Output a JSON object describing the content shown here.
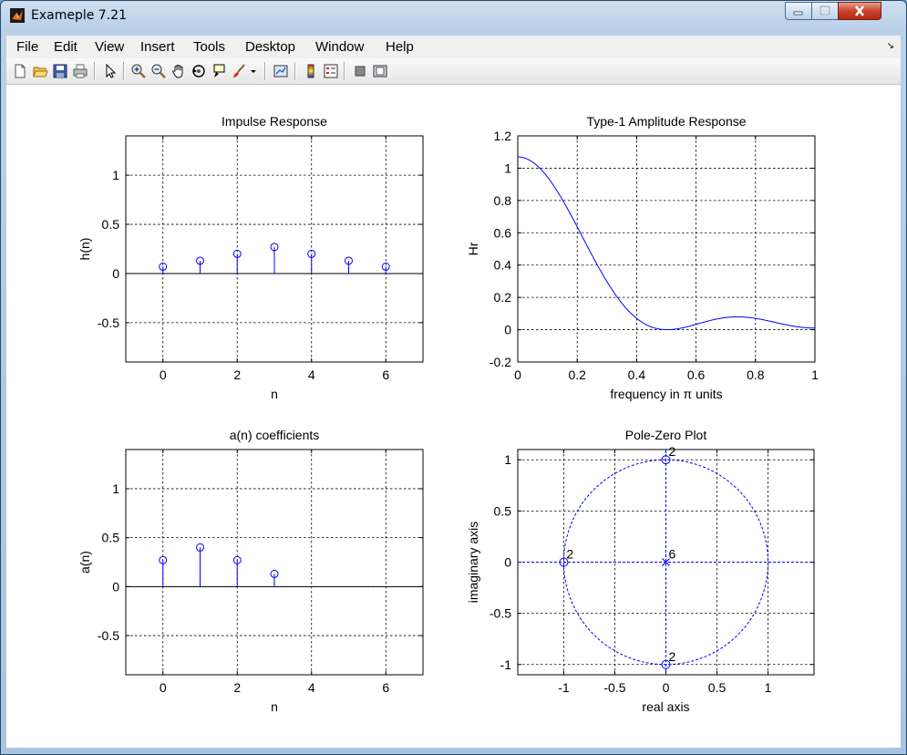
{
  "window": {
    "title": "Exameple 7.21"
  },
  "menu": [
    "File",
    "Edit",
    "View",
    "Insert",
    "Tools",
    "Desktop",
    "Window",
    "Help"
  ],
  "colors": {
    "stem": "#0000ff",
    "grid": "#000000",
    "accent": "#0000ff"
  },
  "toolbar_icons": [
    "new-figure-icon",
    "open-file-icon",
    "save-icon",
    "print-icon",
    "pointer-icon",
    "zoom-in-icon",
    "zoom-out-icon",
    "pan-icon",
    "rotate-icon",
    "data-cursor-icon",
    "brush-icon",
    "brush-dropdown-icon",
    "link-plot-icon",
    "colorbar-icon",
    "legend-icon",
    "hide-plot-tools-icon",
    "show-plot-tools-icon"
  ],
  "chart_data": [
    {
      "type": "stem",
      "title": "Impulse Response",
      "xlabel": "n",
      "ylabel": "h(n)",
      "xlim": [
        -1,
        7
      ],
      "ylim": [
        -0.9,
        1.4
      ],
      "xticks": [
        0,
        2,
        4,
        6
      ],
      "yticks": [
        -0.5,
        0,
        0.5,
        1
      ],
      "ytick_labels": [
        "-0.5",
        "0",
        "0.5",
        "1"
      ],
      "x": [
        0,
        1,
        2,
        3,
        4,
        5,
        6
      ],
      "values": [
        0.07,
        0.13,
        0.2,
        0.27,
        0.2,
        0.13,
        0.07
      ],
      "grid": true
    },
    {
      "type": "line",
      "title": "Type-1 Amplitude Response",
      "xlabel": "frequency in π units",
      "ylabel": "Hr",
      "xlim": [
        0,
        1
      ],
      "ylim": [
        -0.2,
        1.2
      ],
      "xticks": [
        0,
        0.2,
        0.4,
        0.6,
        0.8,
        1
      ],
      "xtick_labels": [
        "0",
        "0.2",
        "0.4",
        "0.6",
        "0.8",
        "1"
      ],
      "yticks": [
        -0.2,
        0,
        0.2,
        0.4,
        0.6,
        0.8,
        1,
        1.2
      ],
      "ytick_labels": [
        "-0.2",
        "0",
        "0.2",
        "0.4",
        "0.6",
        "0.8",
        "1",
        "1.2"
      ],
      "a": [
        0.27,
        0.4,
        0.27,
        0.13
      ],
      "grid": true
    },
    {
      "type": "stem",
      "title": "a(n) coefficients",
      "xlabel": "n",
      "ylabel": "a(n)",
      "xlim": [
        -1,
        7
      ],
      "ylim": [
        -0.9,
        1.4
      ],
      "xticks": [
        0,
        2,
        4,
        6
      ],
      "yticks": [
        -0.5,
        0,
        0.5,
        1
      ],
      "ytick_labels": [
        "-0.5",
        "0",
        "0.5",
        "1"
      ],
      "x": [
        0,
        1,
        2,
        3
      ],
      "values": [
        0.27,
        0.4,
        0.27,
        0.13
      ],
      "grid": true
    },
    {
      "type": "scatter",
      "title": "Pole-Zero Plot",
      "xlabel": "real axis",
      "ylabel": "imaginary axis",
      "xlim": [
        -1.45,
        1.45
      ],
      "ylim": [
        -1.1,
        1.1
      ],
      "xticks": [
        -1,
        -0.5,
        0,
        0.5,
        1
      ],
      "xtick_labels": [
        "-1",
        "-0.5",
        "0",
        "0.5",
        "1"
      ],
      "yticks": [
        -1,
        -0.5,
        0,
        0.5,
        1
      ],
      "ytick_labels": [
        "-1",
        "-0.5",
        "0",
        "0.5",
        "1"
      ],
      "zeros": [
        {
          "re": 0,
          "im": 1,
          "multiplicity": "2"
        },
        {
          "re": -1,
          "im": 0,
          "multiplicity": "2"
        },
        {
          "re": 0,
          "im": -1,
          "multiplicity": "2"
        }
      ],
      "poles": [
        {
          "re": 0,
          "im": 0,
          "multiplicity": "6"
        }
      ],
      "grid": true
    }
  ]
}
